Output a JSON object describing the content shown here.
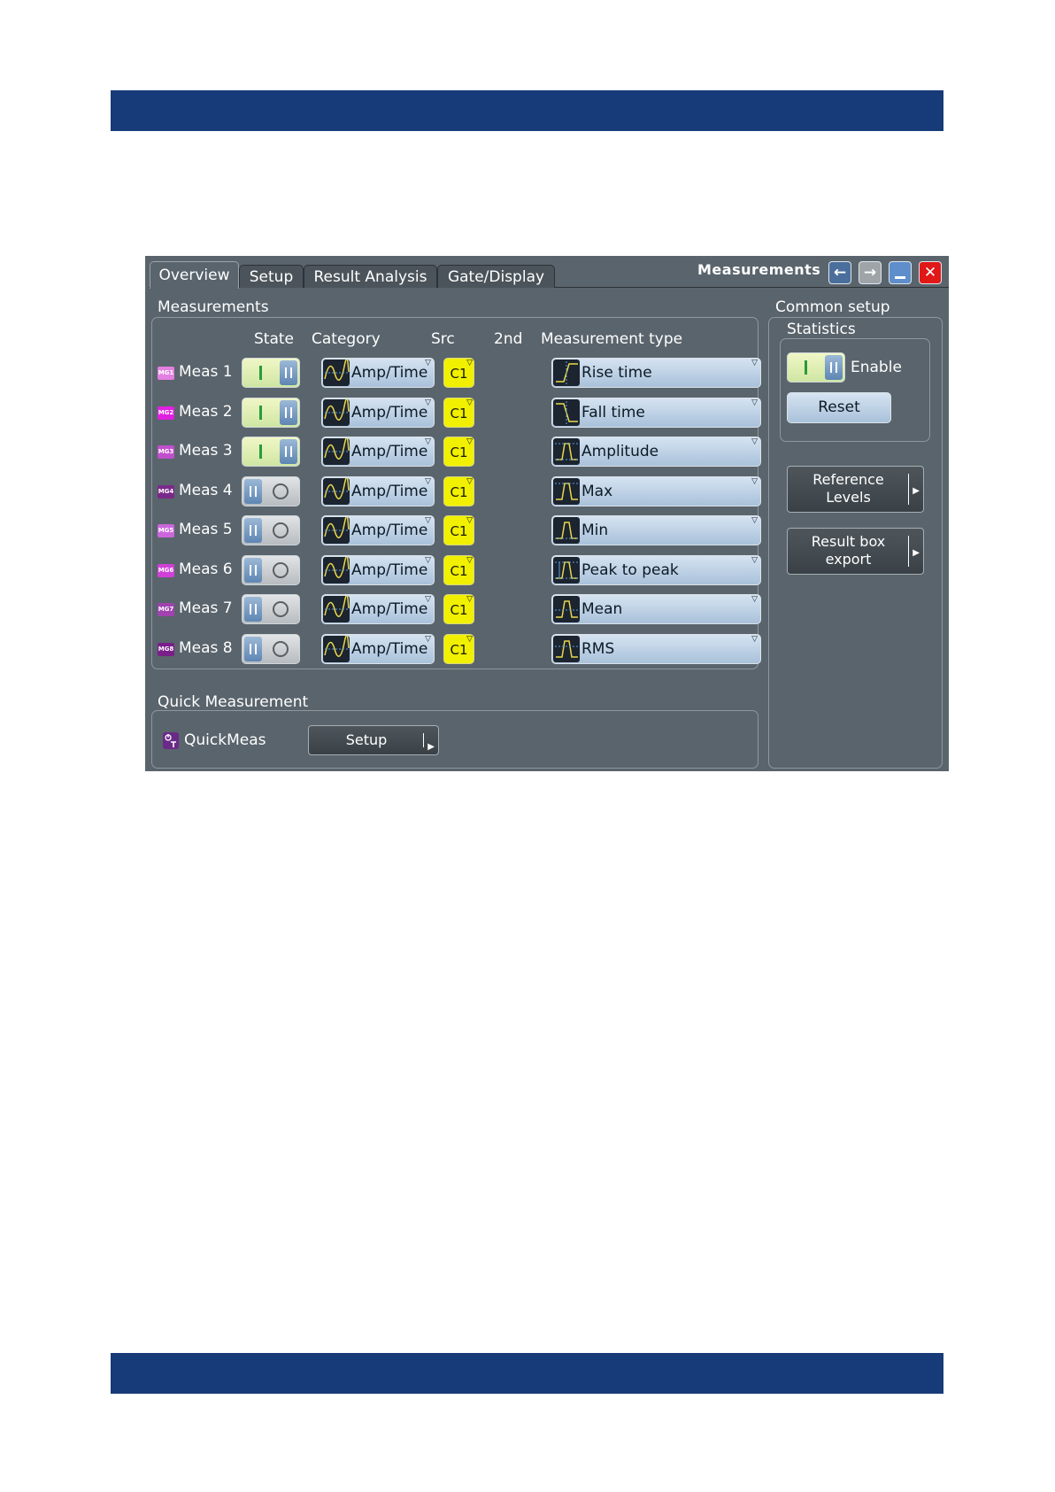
{
  "window": {
    "title": "Measurements",
    "tabs": [
      "Overview",
      "Setup",
      "Result Analysis",
      "Gate/Display"
    ]
  },
  "measurements": {
    "section_label": "Measurements",
    "headers": {
      "state": "State",
      "category": "Category",
      "src": "Src",
      "second": "2nd",
      "type": "Measurement type"
    },
    "rows": [
      {
        "badge": "MG1",
        "label": "Meas 1",
        "category": "Amp/Time",
        "source": "C1",
        "type": "Rise time",
        "state": "on"
      },
      {
        "badge": "MG2",
        "label": "Meas 2",
        "category": "Amp/Time",
        "source": "C1",
        "type": "Fall time",
        "state": "on"
      },
      {
        "badge": "MG3",
        "label": "Meas 3",
        "category": "Amp/Time",
        "source": "C1",
        "type": "Amplitude",
        "state": "on"
      },
      {
        "badge": "MG4",
        "label": "Meas 4",
        "category": "Amp/Time",
        "source": "C1",
        "type": "Max",
        "state": "off"
      },
      {
        "badge": "MG5",
        "label": "Meas 5",
        "category": "Amp/Time",
        "source": "C1",
        "type": "Min",
        "state": "off"
      },
      {
        "badge": "MG6",
        "label": "Meas 6",
        "category": "Amp/Time",
        "source": "C1",
        "type": "Peak to peak",
        "state": "off"
      },
      {
        "badge": "MG7",
        "label": "Meas 7",
        "category": "Amp/Time",
        "source": "C1",
        "type": "Mean",
        "state": "off"
      },
      {
        "badge": "MG8",
        "label": "Meas 8",
        "category": "Amp/Time",
        "source": "C1",
        "type": "RMS",
        "state": "off"
      }
    ]
  },
  "quick": {
    "section_label": "Quick Measurement",
    "label": "QuickMeas",
    "setup_label": "Setup"
  },
  "common": {
    "section_label": "Common setup",
    "statistics_label": "Statistics",
    "enable_label": "Enable",
    "reset_label": "Reset",
    "reference_line1": "Reference",
    "reference_line2": "Levels",
    "export_line1": "Result box",
    "export_line2": "export"
  },
  "colors": {
    "header_bar": "#173a78",
    "panel": "#5a646c",
    "source_yellow": "#f0f000",
    "close_red": "#e01818",
    "badges": [
      "#e37fe0",
      "#e020e0",
      "#c04fcc",
      "#7a2a8a",
      "#cc66dd",
      "#d040d8",
      "#a042b0",
      "#7a1f8a"
    ]
  }
}
